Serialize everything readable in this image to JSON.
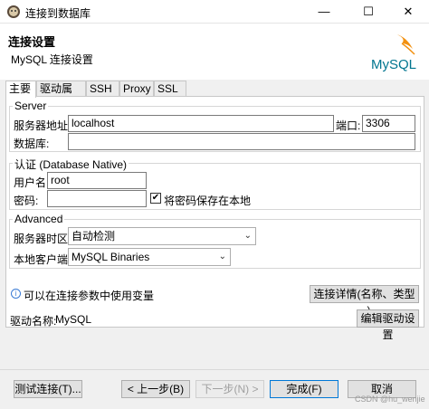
{
  "window": {
    "title": "连接到数据库",
    "minimize_glyph": "—",
    "maximize_glyph": "☐",
    "close_glyph": "✕"
  },
  "header": {
    "title": "连接设置",
    "subtitle": "MySQL 连接设置",
    "logo_text": "MySQL",
    "logo_color": "#00758f",
    "logo_accent": "#f29111"
  },
  "tabs": [
    {
      "label": "主要",
      "active": true
    },
    {
      "label": "驱动属性",
      "active": false
    },
    {
      "label": "SSH",
      "active": false
    },
    {
      "label": "Proxy",
      "active": false
    },
    {
      "label": "SSL",
      "active": false
    }
  ],
  "server": {
    "group_label": "Server",
    "host_label": "服务器地址:",
    "host_value": "localhost",
    "port_label": "端口:",
    "port_value": "3306",
    "database_label": "数据库:",
    "database_value": ""
  },
  "auth": {
    "group_label": "认证 (Database Native)",
    "user_label": "用户名:",
    "user_value": "root",
    "password_label": "密码:",
    "password_value": "",
    "save_password_label": "将密码保存在本地",
    "save_password_checked": true,
    "check_glyph": "✔"
  },
  "advanced": {
    "group_label": "Advanced",
    "timezone_label": "服务器时区:",
    "timezone_value": "自动检测",
    "client_label": "本地客户端:",
    "client_value": "MySQL Binaries",
    "dropdown_glyph": "⌄"
  },
  "info": {
    "icon_glyph": "i",
    "text": "可以在连接参数中使用变量",
    "details_button": "连接详情(名称、类型 ...)"
  },
  "driver": {
    "label": "驱动名称:",
    "value": "MySQL",
    "edit_button": "编辑驱动设置"
  },
  "footer": {
    "test_button": "测试连接(T)...",
    "back_button": "< 上一步(B)",
    "next_button": "下一步(N) >",
    "finish_button": "完成(F)",
    "cancel_button": "取消"
  },
  "watermark": "CSDN @hu_wenjie"
}
